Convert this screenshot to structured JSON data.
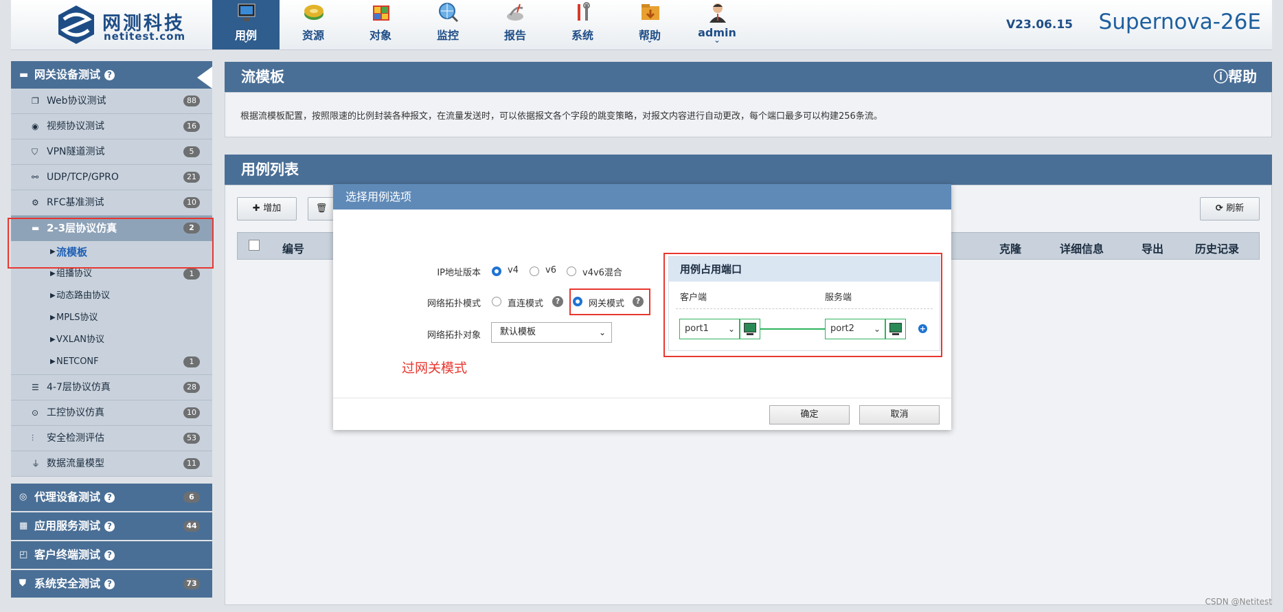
{
  "brand": {
    "name": "网测科技",
    "domain": "netitest.com"
  },
  "nav": [
    {
      "label": "用例",
      "icon": "monitor-icon",
      "active": true,
      "caret": "⌄"
    },
    {
      "label": "资源",
      "icon": "resource-disk-icon",
      "caret": ""
    },
    {
      "label": "对象",
      "icon": "object-box-icon",
      "caret": ""
    },
    {
      "label": "监控",
      "icon": "monitor-globe-icon",
      "caret": ""
    },
    {
      "label": "报告",
      "icon": "report-satellite-icon",
      "caret": ""
    },
    {
      "label": "系统",
      "icon": "tools-icon",
      "caret": ""
    },
    {
      "label": "帮助",
      "icon": "help-folder-icon",
      "caret": "⌄"
    },
    {
      "label": "admin",
      "icon": "user-avatar-icon",
      "caret": "⌄"
    }
  ],
  "version": "V23.06.15",
  "product": "Supernova-26E",
  "sidebar": {
    "top_group": "网关设备测试",
    "items": [
      {
        "label": "Web协议测试",
        "badge": "88"
      },
      {
        "label": "视频协议测试",
        "badge": "16"
      },
      {
        "label": "VPN隧道测试",
        "badge": "5"
      },
      {
        "label": "UDP/TCP/GPRO",
        "badge": "21"
      },
      {
        "label": "RFC基准测试",
        "badge": "10"
      }
    ],
    "category": {
      "label": "2-3层协议仿真",
      "badge": "2"
    },
    "subs": [
      {
        "label": "流模板",
        "badge": ""
      },
      {
        "label": "组播协议",
        "badge": "1"
      },
      {
        "label": "动态路由协议",
        "badge": ""
      },
      {
        "label": "MPLS协议",
        "badge": ""
      },
      {
        "label": "VXLAN协议",
        "badge": ""
      },
      {
        "label": "NETCONF",
        "badge": "1"
      }
    ],
    "items2": [
      {
        "label": "4-7层协议仿真",
        "badge": "28"
      },
      {
        "label": "工控协议仿真",
        "badge": "10"
      },
      {
        "label": "安全检测评估",
        "badge": "53"
      },
      {
        "label": "数据流量模型",
        "badge": "11"
      }
    ],
    "groups": [
      {
        "label": "代理设备测试",
        "badge": "6"
      },
      {
        "label": "应用服务测试",
        "badge": "44"
      },
      {
        "label": "客户终端测试",
        "badge": ""
      },
      {
        "label": "系统安全测试",
        "badge": "73"
      }
    ]
  },
  "template_panel": {
    "title": "流模板",
    "help": "帮助",
    "description": "根据流模板配置，按照限速的比例封装各种报文，在流量发送时，可以依据报文各个字段的跳变策略，对报文内容进行自动更改，每个端口最多可以构建256条流。"
  },
  "list_panel": {
    "title": "用例列表",
    "add": "增加",
    "refresh": "刷新",
    "columns": [
      "编号",
      "克隆",
      "详细信息",
      "导出",
      "历史记录"
    ]
  },
  "modal": {
    "title": "选择用例选项",
    "ip_label": "IP地址版本",
    "ip_options": [
      "v4",
      "v6",
      "v4v6混合"
    ],
    "ip_selected": "v4",
    "topo_label": "网络拓扑模式",
    "topo_options": [
      "直连模式",
      "网关模式"
    ],
    "topo_selected": "网关模式",
    "object_label": "网络拓扑对象",
    "object_value": "默认模板",
    "annotation": "过网关模式",
    "ports": {
      "title": "用例占用端口",
      "client_label": "客户端",
      "server_label": "服务端",
      "client_port": "port1",
      "server_port": "port2"
    },
    "ok": "确定",
    "cancel": "取消"
  },
  "watermark": "CSDN @Netitest",
  "colors": {
    "header_blue": "#4a6f96",
    "accent_red": "#e8362e",
    "link_green": "#2db35d",
    "radio_blue": "#1e73d2"
  }
}
